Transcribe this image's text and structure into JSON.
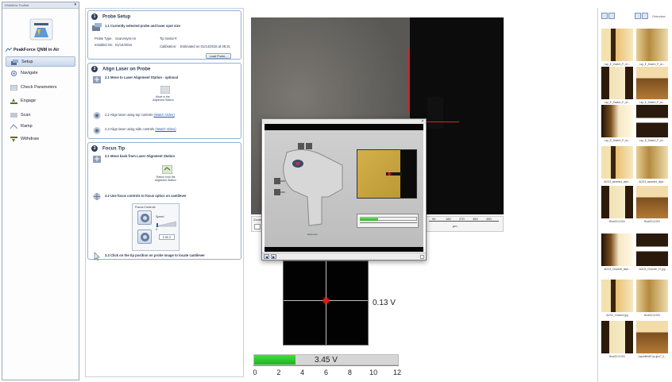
{
  "left_panel": {
    "title": "Workflow Toolbar",
    "workflow_name": "PeakForce QNM in Air",
    "items": [
      {
        "label": "Setup",
        "selected": true,
        "icon": "setup-icon"
      },
      {
        "label": "Navigate",
        "selected": false,
        "icon": "navigate-icon"
      },
      {
        "label": "Check Parameters",
        "selected": false,
        "icon": "check-parameters-icon"
      },
      {
        "label": "Engage",
        "selected": false,
        "icon": "engage-icon"
      },
      {
        "label": "Scan",
        "selected": false,
        "icon": "scan-icon"
      },
      {
        "label": "Ramp",
        "selected": false,
        "icon": "ramp-icon"
      },
      {
        "label": "Withdraw",
        "selected": false,
        "icon": "withdraw-icon"
      }
    ]
  },
  "wizard": {
    "probe_setup": {
      "number": "1",
      "title": "Probe Setup",
      "sub": "1.1 Currently selected probe and laser spot size",
      "probe_type_label": "Probe Type:",
      "probe_type_value": "ScanAsyst-Air",
      "tip_serial_label": "Tip Serial #:",
      "installed_label": "Installed On:",
      "installed_value": "01/14/2016",
      "calibration_label": "Calibration:",
      "calibration_value": "Estimated on 01/14/2016 at 08:31",
      "load_probe_button": "Load Probe..."
    },
    "align_laser": {
      "number": "2",
      "title": "Align Laser on Probe",
      "s1": "2.1 Move to Laser Alignment Station - optional",
      "move_button_line1": "Move to the",
      "move_button_line2": "Alignment Station",
      "s2_prefix": "2.2 Align laser using top controls ",
      "s2_link": "(Watch Video)",
      "s3_prefix": "2.3 Align laser using side controls ",
      "s3_link": "(Watch Video)"
    },
    "focus_tip": {
      "number": "3",
      "title": "Focus Tip",
      "s1": "3.1 Move back from Laser Alignment Station",
      "return_button_line1": "Return from the",
      "return_button_line2": "Alignment Station",
      "s2": "3.2 Use focus controls to focus optics on cantilever",
      "focus_controls_label": "Focus Controls",
      "speed_label": "Speed",
      "speed_min": "0",
      "speed_value": "2.00 X",
      "s3": "3.3 Click on the tip position on probe image to locate cantilever"
    }
  },
  "camera": {
    "zoom_label": "Zoom",
    "ruler_ticks": [
      "90",
      "180",
      "270",
      "360",
      "450"
    ],
    "ruler_unit": "μm"
  },
  "video": {
    "close_glyph": "×",
    "stage_caption": "alignment",
    "meter_level": 0.32
  },
  "detector": {
    "value_label": "0.13 V"
  },
  "sum": {
    "value_label": "3.45  V",
    "value": 3.45,
    "max": 12,
    "ticks": [
      "0",
      "2",
      "4",
      "6",
      "8",
      "10",
      "12"
    ],
    "bar_color": "#2ec42e"
  },
  "gallery": {
    "header_label": "Overview",
    "thumbnails": [
      {
        "caption": "Lsp_E_Zbatch_P_ch..."
      },
      {
        "caption": "Lsp_E_Zbatch_P_ch..."
      },
      {
        "caption": "Lsp_E_Zbatch_P_ch..."
      },
      {
        "caption": "Lsp_E_Zbatch_P_ch..."
      },
      {
        "caption": "Lsp_E_Zbatch_P_ch..."
      },
      {
        "caption": "Lsp_E_Zbatch_P_ch..."
      },
      {
        "caption": "Al2O3_asserted_dept..."
      },
      {
        "caption": "Al2O3_asserted_dept..."
      },
      {
        "caption": "Blue2012.004"
      },
      {
        "caption": "Blue2012.003"
      },
      {
        "caption": "Al2O3_Channel_dept..."
      },
      {
        "caption": "Al2O3_Channel_07.jpg"
      },
      {
        "caption": "Al2O3_Channel.jpg"
      },
      {
        "caption": "Blue2012.003"
      },
      {
        "caption": "Blue2012.003"
      },
      {
        "caption": "Liquidfield2Cyc.jpm7_0..."
      }
    ]
  }
}
